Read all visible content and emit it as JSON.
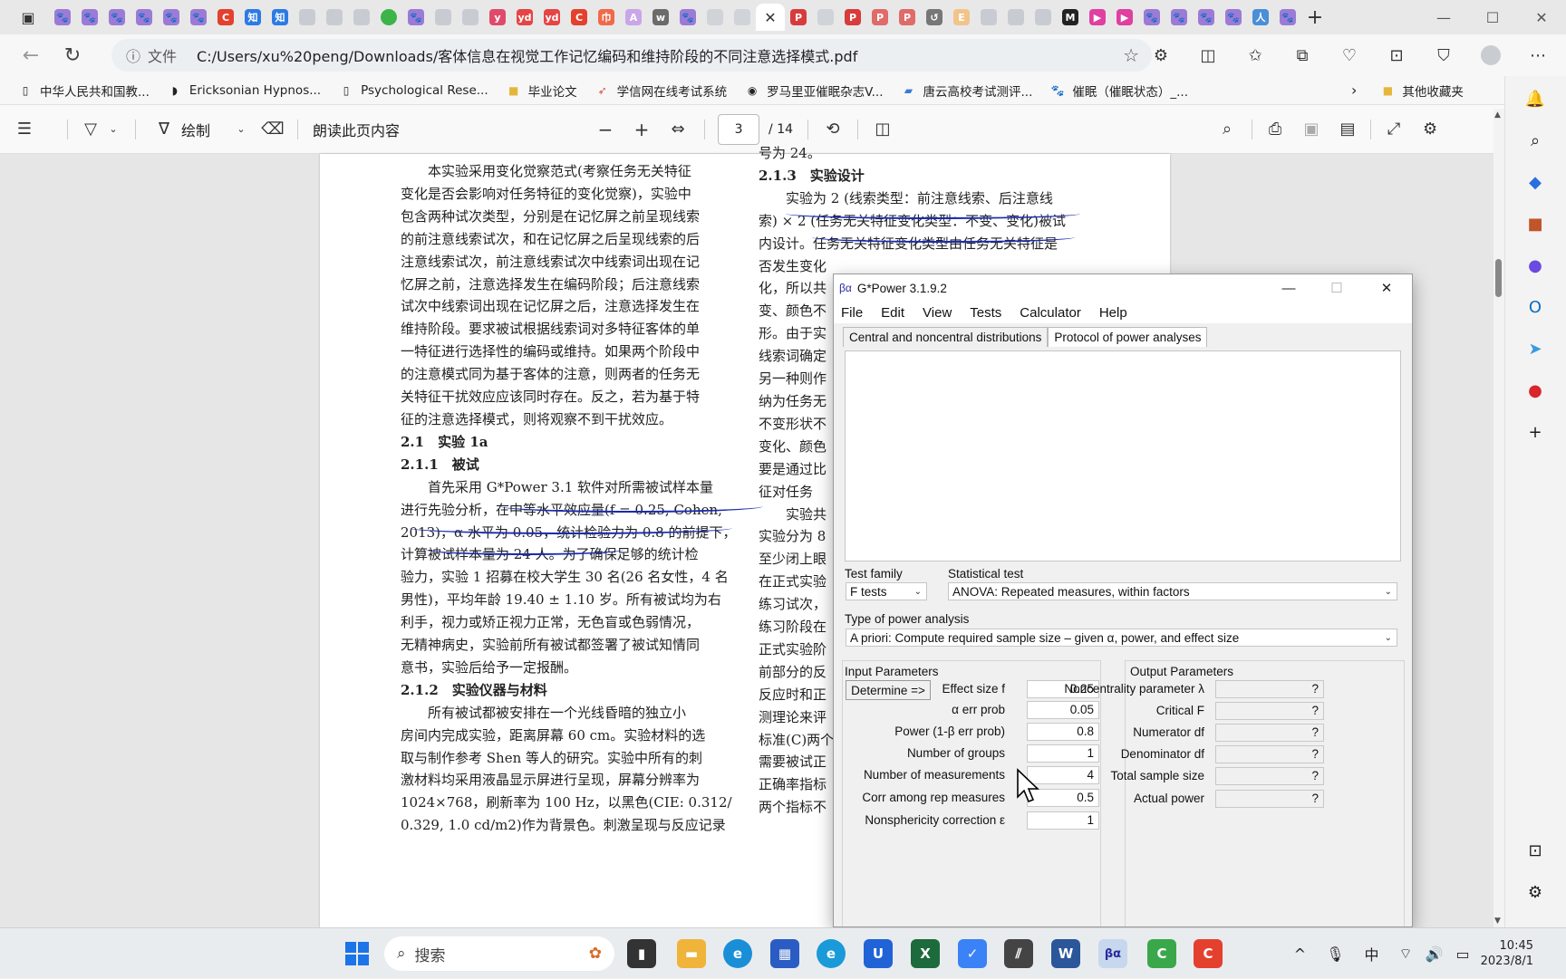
{
  "browser": {
    "url": "C:/Users/xu%20peng/Downloads/客体信息在视觉工作记忆编码和维持阶段的不同注意选择模式.pdf",
    "file_label": "文件",
    "bookmarks": [
      "中华人民共和国教...",
      "Ericksonian Hypnos...",
      "Psychological Rese...",
      "毕业论文",
      "学信网在线考试系统",
      "罗马里亚催眠杂志V...",
      "唐云高校考试测评...",
      "催眠（催眠状态）_...",
      "其他收藏夹"
    ]
  },
  "pdf_toolbar": {
    "draw_label": "绘制",
    "read_label": "朗读此页内容",
    "page_current": "3",
    "page_total": "/ 14"
  },
  "doc": {
    "left_col": [
      "　　本实验采用变化觉察范式(考察任务无关特征",
      "变化是否会影响对任务特征的变化觉察)，实验中",
      "包含两种试次类型，分别是在记忆屏之前呈现线索",
      "的前注意线索试次，和在记忆屏之后呈现线索的后",
      "注意线索试次，前注意线索试次中线索词出现在记",
      "忆屏之前，注意选择发生在编码阶段；后注意线索",
      "试次中线索词出现在记忆屏之后，注意选择发生在",
      "维持阶段。要求被试根据线索词对多特征客体的单",
      "一特征进行选择性的编码或维持。如果两个阶段中",
      "的注意模式同为基于客体的注意，则两者的任务无",
      "关特征干扰效应应该同时存在。反之，若为基于特",
      "征的注意选择模式，则将观察不到干扰效应。",
      "2.1　实验 1a",
      "2.1.1　被试",
      "　　首先采用 G*Power 3.1 软件对所需被试样本量",
      "进行先验分析，在中等水平效应量(f = 0.25, Cohen,",
      "2013)，α 水平为 0.05，统计检验力为 0.8 的前提下，",
      "计算被试样本量为 24 人。为了确保足够的统计检",
      "验力，实验 1 招募在校大学生 30 名(26 名女性，4 名",
      "男性)，平均年龄 19.40 ± 1.10 岁。所有被试均为右",
      "利手，视力或矫正视力正常，无色盲或色弱情况，",
      "无精神病史，实验前所有被试都签署了被试知情同",
      "意书，实验后给予一定报酬。",
      "2.1.2　实验仪器与材料",
      "　　所有被试都被安排在一个光线昏暗的独立小",
      "房间内完成实验，距离屏幕 60 cm。实验材料的选",
      "取与制作参考 Shen 等人的研究。实验中所有的刺",
      "激材料均采用液晶显示屏进行呈现，屏幕分辨率为",
      "1024×768，刷新率为 100 Hz，以黑色(CIE: 0.312/",
      "0.329, 1.0 cd/m2)作为背景色。刺激呈现与反应记录"
    ],
    "right_col": [
      "号为 24。",
      "2.1.3　实验设计",
      "　　实验为 2 (线索类型：前注意线索、后注意线",
      "索) × 2 (任务无关特征变化类型：不变、变化)被试",
      "内设计。任务无关特征变化类型由任务无关特征是",
      "否发生变化",
      "化，所以共",
      "变、颜色不",
      "形。由于实",
      "线索词确定",
      "另一种则作",
      "纳为任务无",
      "不变形状不",
      "变化、颜色",
      "要是通过比",
      "征对任务",
      "　　实验共",
      "实验分为 8",
      "至少闭上眼",
      "在正式实验",
      "练习试次，",
      "练习阶段在",
      "正式实验阶",
      "前部分的反",
      "反应时和正",
      "测理论来评",
      "标准(C)两个",
      "需要被试正",
      "正确率指标",
      "两个指标不"
    ]
  },
  "gpower": {
    "title": "G*Power 3.1.9.2",
    "menu": [
      "File",
      "Edit",
      "View",
      "Tests",
      "Calculator",
      "Help"
    ],
    "tabs": [
      "Central and noncentral distributions",
      "Protocol of power analyses"
    ],
    "test_family_label": "Test family",
    "test_family": "F tests",
    "statistical_test_label": "Statistical test",
    "statistical_test": "ANOVA: Repeated measures, within factors",
    "power_analysis_label": "Type of power analysis",
    "power_analysis": "A priori: Compute required sample size – given α, power, and effect size",
    "input_label": "Input Parameters",
    "output_label": "Output Parameters",
    "determine_label": "Determine =>",
    "inputs": [
      {
        "label": "Effect size f",
        "value": "0.25"
      },
      {
        "label": "α err prob",
        "value": "0.05"
      },
      {
        "label": "Power (1-β err prob)",
        "value": "0.8"
      },
      {
        "label": "Number of groups",
        "value": "1"
      },
      {
        "label": "Number of measurements",
        "value": "4"
      },
      {
        "label": "Corr among rep measures",
        "value": "0.5"
      },
      {
        "label": "Nonsphericity correction ε",
        "value": "1"
      }
    ],
    "outputs": [
      {
        "label": "Noncentrality parameter λ",
        "value": "?"
      },
      {
        "label": "Critical F",
        "value": "?"
      },
      {
        "label": "Numerator df",
        "value": "?"
      },
      {
        "label": "Denominator df",
        "value": "?"
      },
      {
        "label": "Total sample size",
        "value": "?"
      },
      {
        "label": "Actual power",
        "value": "?"
      }
    ]
  },
  "taskbar": {
    "search_label": "搜索",
    "ime": "中",
    "time": "10:45",
    "date": "2023/8/1"
  }
}
